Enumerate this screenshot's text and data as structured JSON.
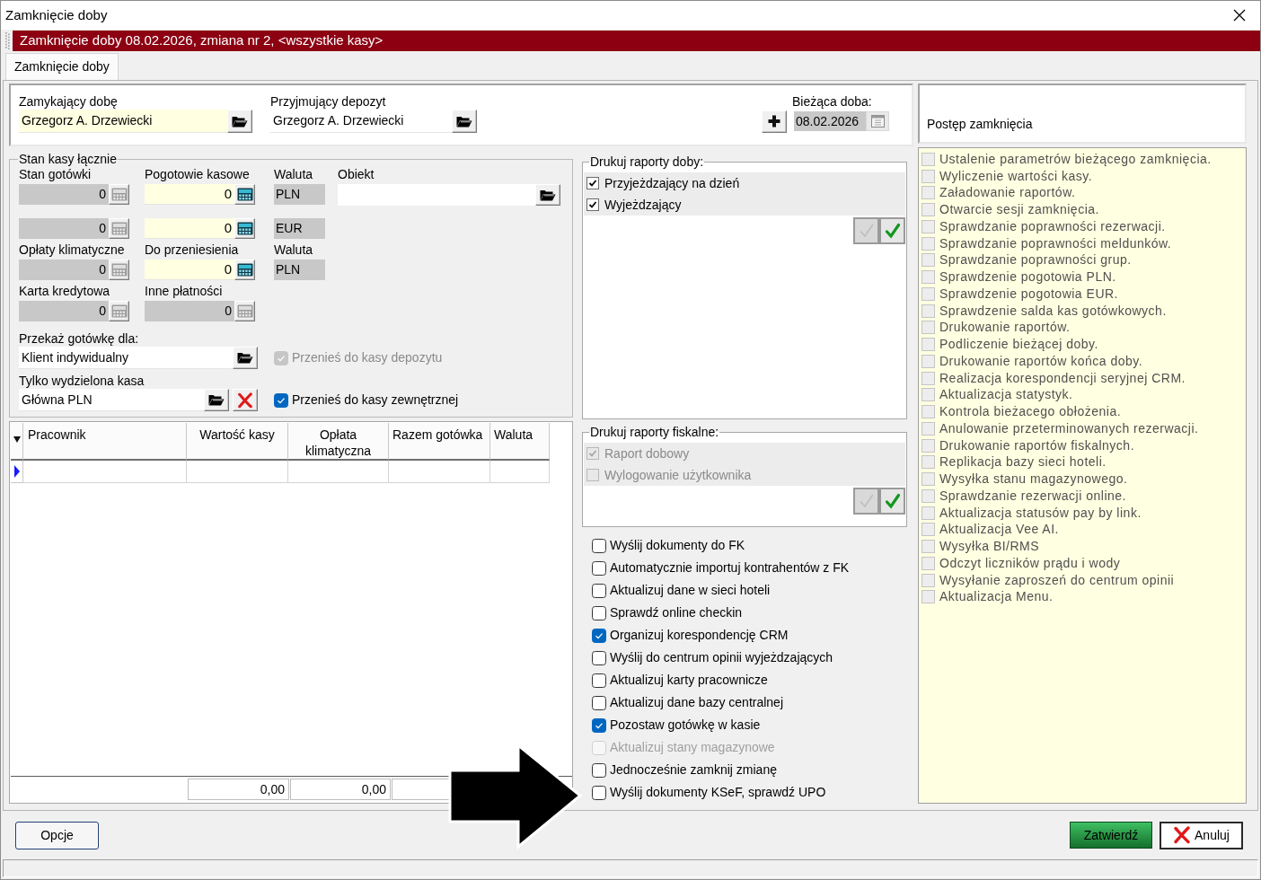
{
  "window": {
    "title": "Zamknięcie doby"
  },
  "header": {
    "title": "Zamknięcie doby 08.02.2026, zmiana nr 2, <wszystkie kasy>"
  },
  "tabs": [
    {
      "label": "Zamknięcie doby",
      "selected": true
    }
  ],
  "closing": {
    "closer": {
      "label": "Zamykający dobę",
      "value": "Grzegorz A. Drzewiecki"
    },
    "receiver": {
      "label": "Przyjmujący depozyt",
      "value": "Grzegorz A. Drzewiecki"
    },
    "current_day": {
      "label": "Bieżąca doba:",
      "value": "08.02.2026"
    }
  },
  "cash_state": {
    "title": "Stan kasy łącznie",
    "rows": [
      {
        "labels": [
          "Stan gotówki",
          "Pogotowie kasowe",
          "Waluta",
          "Obiekt"
        ],
        "fields": [
          {
            "kind": "readonly",
            "value": "0"
          },
          {
            "kind": "editable",
            "value": "0"
          },
          {
            "kind": "currency",
            "value": "PLN"
          },
          {
            "kind": "lookup"
          }
        ]
      },
      {
        "fields": [
          {
            "kind": "readonly",
            "value": "0"
          },
          {
            "kind": "editable",
            "value": "0"
          },
          {
            "kind": "currency",
            "value": "EUR"
          }
        ]
      },
      {
        "labels": [
          "Opłaty klimatyczne",
          "Do przeniesienia",
          "Waluta"
        ],
        "fields": [
          {
            "kind": "readonly",
            "value": "0"
          },
          {
            "kind": "editable",
            "value": "0"
          },
          {
            "kind": "currency",
            "value": "PLN"
          }
        ]
      },
      {
        "labels": [
          "Karta kredytowa",
          "Inne płatności"
        ],
        "fields": [
          {
            "kind": "readonly",
            "value": "0"
          },
          {
            "kind": "readonly",
            "value": "0"
          }
        ]
      }
    ],
    "recipient": {
      "label": "Przekaż gotówkę dla:",
      "value": "Klient indywidualny"
    },
    "deposit_transfer": {
      "label": "Przenieś do kasy depozytu",
      "checked": true,
      "disabled": true
    },
    "register": {
      "label": "Tylko wydzielona kasa",
      "value": "Główna PLN"
    },
    "external_transfer": {
      "label": "Przenieś do kasy zewnętrznej",
      "checked": true,
      "disabled": false
    }
  },
  "cashier_table": {
    "columns": [
      "Pracownik",
      "Wartość kasy",
      "Opłata klimatyczna",
      "Razem gotówka",
      "Waluta"
    ],
    "rows": [
      {
        "selected": true
      }
    ],
    "totals": [
      "0,00",
      "0,00"
    ]
  },
  "daily_reports": {
    "title": "Drukuj raporty doby:",
    "items": [
      {
        "label": "Przyjeżdzający na dzień",
        "checked": true,
        "disabled": false
      },
      {
        "label": "Wyjeżdzający",
        "checked": true,
        "disabled": false
      }
    ]
  },
  "fiscal_reports": {
    "title": "Drukuj raporty fiskalne:",
    "items": [
      {
        "label": "Raport dobowy",
        "checked": true,
        "disabled": true
      },
      {
        "label": "Wylogowanie użytkownika",
        "checked": false,
        "disabled": true
      }
    ]
  },
  "options": [
    {
      "label": "Wyślij dokumenty do FK",
      "checked": false,
      "disabled": false
    },
    {
      "label": "Automatycznie importuj kontrahentów z FK",
      "checked": false,
      "disabled": false
    },
    {
      "label": "Aktualizuj dane w sieci hoteli",
      "checked": false,
      "disabled": false
    },
    {
      "label": "Sprawdź online checkin",
      "checked": false,
      "disabled": false
    },
    {
      "label": "Organizuj korespondencję CRM",
      "checked": true,
      "disabled": false
    },
    {
      "label": "Wyślij do centrum opinii wyjeżdzających",
      "checked": false,
      "disabled": false
    },
    {
      "label": "Aktualizuj karty pracownicze",
      "checked": false,
      "disabled": false
    },
    {
      "label": "Aktualizuj dane bazy centralnej",
      "checked": false,
      "disabled": false
    },
    {
      "label": "Pozostaw gotówkę w kasie",
      "checked": true,
      "disabled": false
    },
    {
      "label": "Aktualizuj stany magazynowe",
      "checked": false,
      "disabled": true
    },
    {
      "label": "Jednocześnie zamknij zmianę",
      "checked": false,
      "disabled": false
    },
    {
      "label": "Wyślij dokumenty KSeF, sprawdź UPO",
      "checked": false,
      "disabled": false
    }
  ],
  "progress": {
    "title": "Postęp zamknięcia",
    "steps": [
      {
        "label": "Ustalenie parametrów bieżącego zamknięcia.",
        "checked": false
      },
      {
        "label": "Wyliczenie wartości kasy.",
        "checked": false
      },
      {
        "label": "Załadowanie raportów.",
        "checked": false
      },
      {
        "label": "Otwarcie sesji zamknięcia.",
        "checked": false
      },
      {
        "label": "Sprawdzanie poprawności rezerwacji.",
        "checked": false
      },
      {
        "label": "Sprawdzanie poprawności meldunków.",
        "checked": false
      },
      {
        "label": "Sprawdzanie poprawności grup.",
        "checked": false
      },
      {
        "label": "Sprawdzenie pogotowia PLN.",
        "checked": false
      },
      {
        "label": "Sprawdzenie pogotowia EUR.",
        "checked": false
      },
      {
        "label": "Sprawdzenie salda kas gotówkowych.",
        "checked": false
      },
      {
        "label": "Drukowanie raportów.",
        "checked": false
      },
      {
        "label": "Podliczenie bieżącej doby.",
        "checked": false
      },
      {
        "label": "Drukowanie raportów końca doby.",
        "checked": false
      },
      {
        "label": "Realizacja korespondencji seryjnej CRM.",
        "checked": false
      },
      {
        "label": "Aktualizacja statystyk.",
        "checked": false
      },
      {
        "label": "Kontrola bieżacego obłożenia.",
        "checked": false
      },
      {
        "label": "Anulowanie przeterminowanych rezerwacji.",
        "checked": false
      },
      {
        "label": "Drukowanie raportów fiskalnych.",
        "checked": false
      },
      {
        "label": "Replikacja bazy sieci hoteli.",
        "checked": false
      },
      {
        "label": "Wysyłka stanu magazynowego.",
        "checked": false
      },
      {
        "label": "Sprawdzanie rezerwacji online.",
        "checked": false
      },
      {
        "label": "Aktualizacja statusów pay by link.",
        "checked": false
      },
      {
        "label": "Aktualizacja Vee AI.",
        "checked": false
      },
      {
        "label": "Wysyłka BI/RMS",
        "checked": false
      },
      {
        "label": "Odczyt liczników prądu i wody",
        "checked": false
      },
      {
        "label": "Wysyłanie zaproszeń do centrum opinii",
        "checked": false
      },
      {
        "label": "Aktualizacja Menu.",
        "checked": false
      }
    ]
  },
  "buttons": [
    {
      "kind": "options",
      "label": "Opcje"
    },
    {
      "kind": "confirm",
      "label": "Zatwierdź"
    },
    {
      "kind": "cancel",
      "label": "Anuluj"
    }
  ]
}
